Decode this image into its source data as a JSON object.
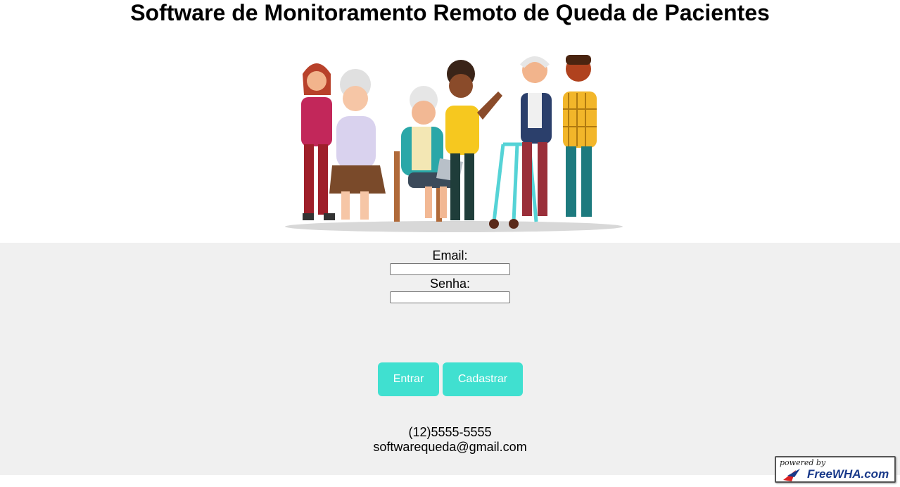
{
  "page": {
    "title": "Software de Monitoramento Remoto de Queda de Pacientes"
  },
  "login": {
    "email_label": "Email:",
    "email_value": "",
    "password_label": "Senha:",
    "password_value": "",
    "enter_button": "Entrar",
    "register_button": "Cadastrar"
  },
  "contact": {
    "phone": "(12)5555-5555",
    "email": "softwarequeda@gmail.com"
  },
  "badge": {
    "powered_by": "powered by",
    "brand": "FreeWHA.com"
  },
  "colors": {
    "button": "#40e0d0",
    "panel": "#f0f0f0"
  },
  "illustration": {
    "icon": "people-group-illustration"
  }
}
